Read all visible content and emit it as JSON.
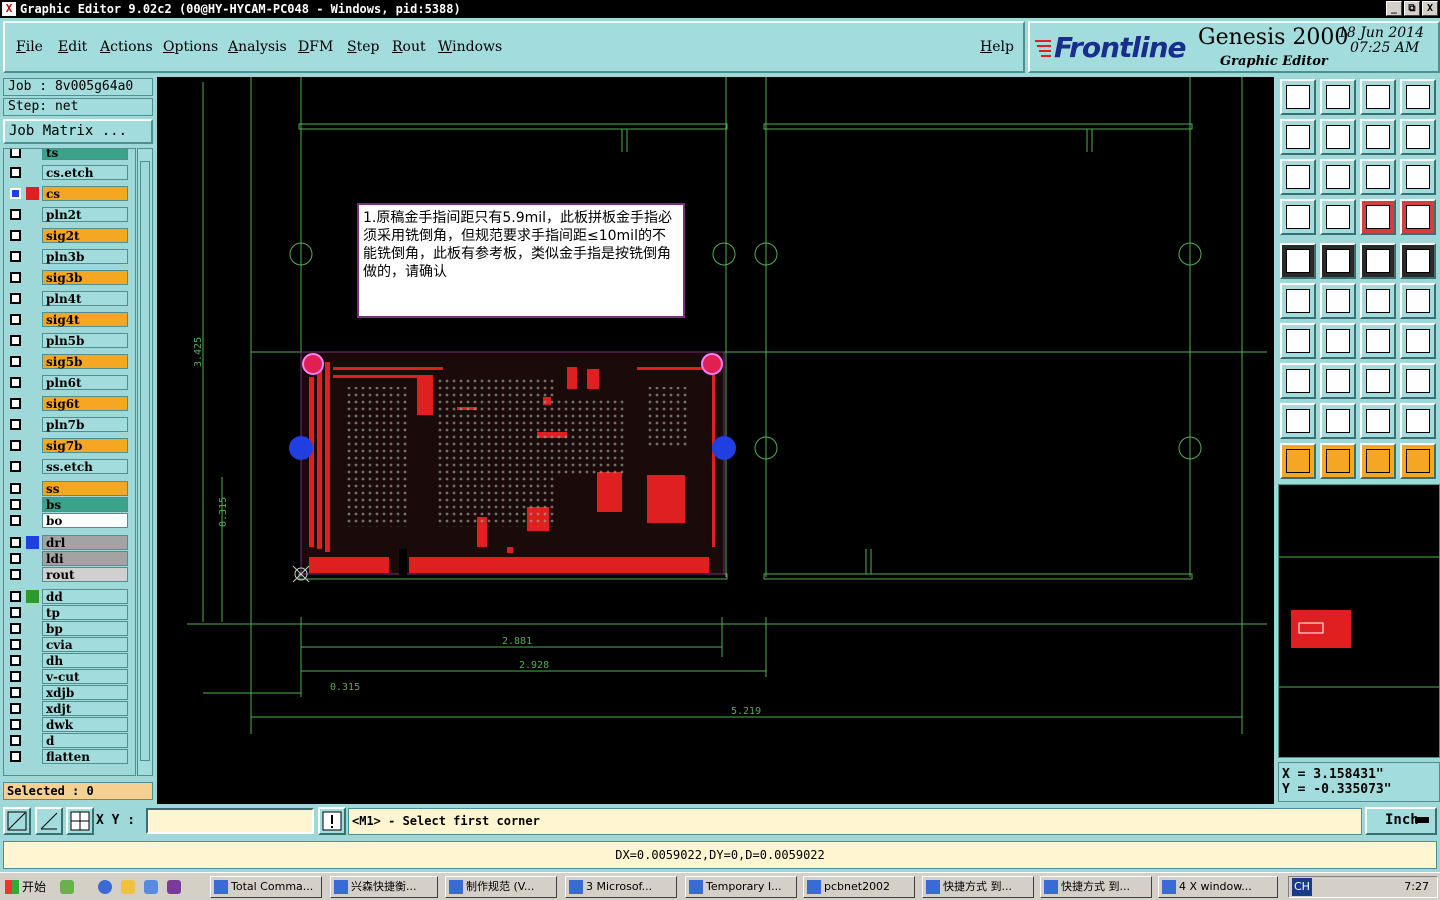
{
  "window": {
    "title": "Graphic Editor 9.02c2  (00@HY-HYCAM-PC048 - Windows, pid:5388)",
    "controls": [
      "_",
      "⧉",
      "X"
    ]
  },
  "menu": {
    "items": [
      "File",
      "Edit",
      "Actions",
      "Options",
      "Analysis",
      "DFM",
      "Step",
      "Rout",
      "Windows"
    ],
    "help": "Help"
  },
  "logo": {
    "brand": "Frontline",
    "product": "Genesis 2000",
    "subtitle": "Graphic Editor",
    "date": "18 Jun 2014",
    "time": "07:25 AM"
  },
  "left": {
    "job": "Job : 8v005g64a0",
    "step": "Step: net",
    "job_matrix": "Job Matrix ...",
    "selected": "Selected : 0",
    "layers": [
      {
        "name": "ts",
        "color": "#3aa38a",
        "swatch": ""
      },
      {
        "name": "cs.etch",
        "color": "#a3dcdc",
        "swatch": ""
      },
      {
        "name": "cs",
        "color": "#f5a623",
        "swatch": "#e02020",
        "active": true
      },
      {
        "name": "pln2t",
        "color": "#a3dcdc",
        "swatch": ""
      },
      {
        "name": "sig2t",
        "color": "#f5a623",
        "swatch": ""
      },
      {
        "name": "pln3b",
        "color": "#a3dcdc",
        "swatch": ""
      },
      {
        "name": "sig3b",
        "color": "#f5a623",
        "swatch": ""
      },
      {
        "name": "pln4t",
        "color": "#a3dcdc",
        "swatch": ""
      },
      {
        "name": "sig4t",
        "color": "#f5a623",
        "swatch": ""
      },
      {
        "name": "pln5b",
        "color": "#a3dcdc",
        "swatch": ""
      },
      {
        "name": "sig5b",
        "color": "#f5a623",
        "swatch": ""
      },
      {
        "name": "pln6t",
        "color": "#a3dcdc",
        "swatch": ""
      },
      {
        "name": "sig6t",
        "color": "#f5a623",
        "swatch": ""
      },
      {
        "name": "pln7b",
        "color": "#a3dcdc",
        "swatch": ""
      },
      {
        "name": "sig7b",
        "color": "#f5a623",
        "swatch": ""
      },
      {
        "name": "ss.etch",
        "color": "#a3dcdc",
        "swatch": ""
      },
      {
        "name": "ss",
        "color": "#f5a623",
        "swatch": "",
        "gap": true
      },
      {
        "name": "bs",
        "color": "#3aa38a",
        "swatch": ""
      },
      {
        "name": "bo",
        "color": "#ffffff",
        "swatch": ""
      },
      {
        "name": "drl",
        "color": "#a3a3a3",
        "swatch": "#1f3fe0",
        "gap": true
      },
      {
        "name": "ldi",
        "color": "#a3a3a3",
        "swatch": ""
      },
      {
        "name": "rout",
        "color": "#d0d0d0",
        "swatch": ""
      },
      {
        "name": "dd",
        "color": "#a3dcdc",
        "swatch": "#2e9a2e",
        "gap": true
      },
      {
        "name": "tp",
        "color": "#a3dcdc",
        "swatch": ""
      },
      {
        "name": "bp",
        "color": "#a3dcdc",
        "swatch": ""
      },
      {
        "name": "cvia",
        "color": "#a3dcdc",
        "swatch": ""
      },
      {
        "name": "dh",
        "color": "#a3dcdc",
        "swatch": ""
      },
      {
        "name": "v-cut",
        "color": "#a3dcdc",
        "swatch": ""
      },
      {
        "name": "xdjb",
        "color": "#a3dcdc",
        "swatch": ""
      },
      {
        "name": "xdjt",
        "color": "#a3dcdc",
        "swatch": ""
      },
      {
        "name": "dwk",
        "color": "#a3dcdc",
        "swatch": ""
      },
      {
        "name": "d",
        "color": "#a3dcdc",
        "swatch": ""
      },
      {
        "name": "flatten",
        "color": "#a3dcdc",
        "swatch": ""
      }
    ]
  },
  "canvas": {
    "note": "1.原稿金手指间距只有5.9mil，此板拼板金手指必须采用铣倒角，但规范要求手指间距≤10mil的不能铣倒角，此板有参考板，类似金手指是按铣倒角做的，请确认",
    "dims": {
      "d1": "2.881",
      "d2": "2.928",
      "d3": "0.315",
      "d4": "5.219",
      "v1": "3.425",
      "v2": "0.315"
    }
  },
  "coords": {
    "x": "X =  3.158431\"",
    "y": "Y = -0.335073\""
  },
  "status": {
    "xy_label": "X Y :",
    "prompt": "<M1> - Select first corner",
    "unit": "Inch",
    "measure": "DX=0.0059022,DY=0,D=0.0059022"
  },
  "taskbar": {
    "start": "开始",
    "tasks": [
      "Total Comma...",
      "兴森快捷衡...",
      "制作规范  (V...",
      "3 Microsof...",
      "Temporary I...",
      "pcbnet2002",
      "快捷方式 到...",
      "快捷方式 到...",
      "4 X window..."
    ],
    "lang": "CH",
    "clock": "7:27"
  },
  "colors": {
    "panel": "#a3dcdc",
    "canvas": "#000000",
    "copper": "#e02020",
    "outline": "#4fb04f",
    "drill": "#1f3fe0"
  }
}
